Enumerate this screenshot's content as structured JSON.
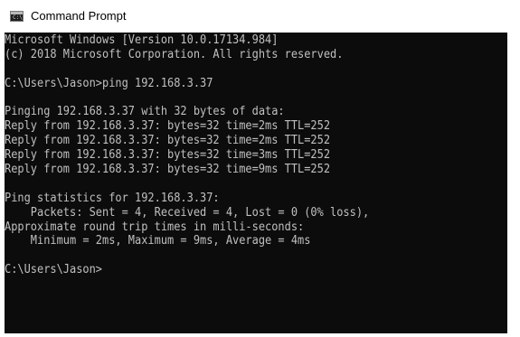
{
  "window": {
    "title": "Command Prompt",
    "icon": "command-prompt-icon",
    "icon_glyph": "C:\\"
  },
  "console": {
    "background": "#0c0c0c",
    "foreground": "#c0c0c0",
    "lines": [
      "Microsoft Windows [Version 10.0.17134.984]",
      "(c) 2018 Microsoft Corporation. All rights reserved.",
      "",
      "C:\\Users\\Jason>ping 192.168.3.37",
      "",
      "Pinging 192.168.3.37 with 32 bytes of data:",
      "Reply from 192.168.3.37: bytes=32 time=2ms TTL=252",
      "Reply from 192.168.3.37: bytes=32 time=2ms TTL=252",
      "Reply from 192.168.3.37: bytes=32 time=3ms TTL=252",
      "Reply from 192.168.3.37: bytes=32 time=9ms TTL=252",
      "",
      "Ping statistics for 192.168.3.37:",
      "    Packets: Sent = 4, Received = 4, Lost = 0 (0% loss),",
      "Approximate round trip times in milli-seconds:",
      "    Minimum = 2ms, Maximum = 9ms, Average = 4ms",
      "",
      "C:\\Users\\Jason>"
    ]
  }
}
